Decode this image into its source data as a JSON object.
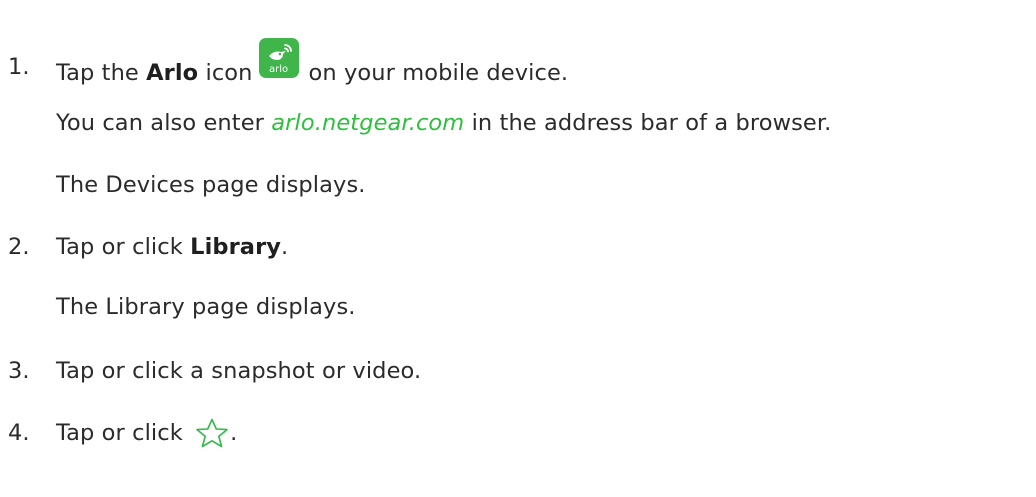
{
  "steps": [
    {
      "number": "1.",
      "pre": "Tap the ",
      "bold": "Arlo",
      "post_bold": " icon",
      "icon": "arlo-app-icon",
      "icon_text": "arlo",
      "after_icon": "on your mobile device.",
      "note": {
        "pre": "You can also enter ",
        "link": "arlo.netgear.com",
        "post": " in the address bar of a browser."
      },
      "result": "The Devices page displays."
    },
    {
      "number": "2.",
      "pre": "Tap or click ",
      "bold": "Library",
      "post": ".",
      "result": "The Library page displays."
    },
    {
      "number": "3.",
      "text": "Tap or click a snapshot or video."
    },
    {
      "number": "4.",
      "pre": "Tap or click ",
      "icon": "star-outline-icon",
      "post": "."
    }
  ],
  "colors": {
    "text": "#2b2b2b",
    "link": "#2fbf3e",
    "icon_green": "#3fb54a",
    "star_green": "#33b84a"
  }
}
